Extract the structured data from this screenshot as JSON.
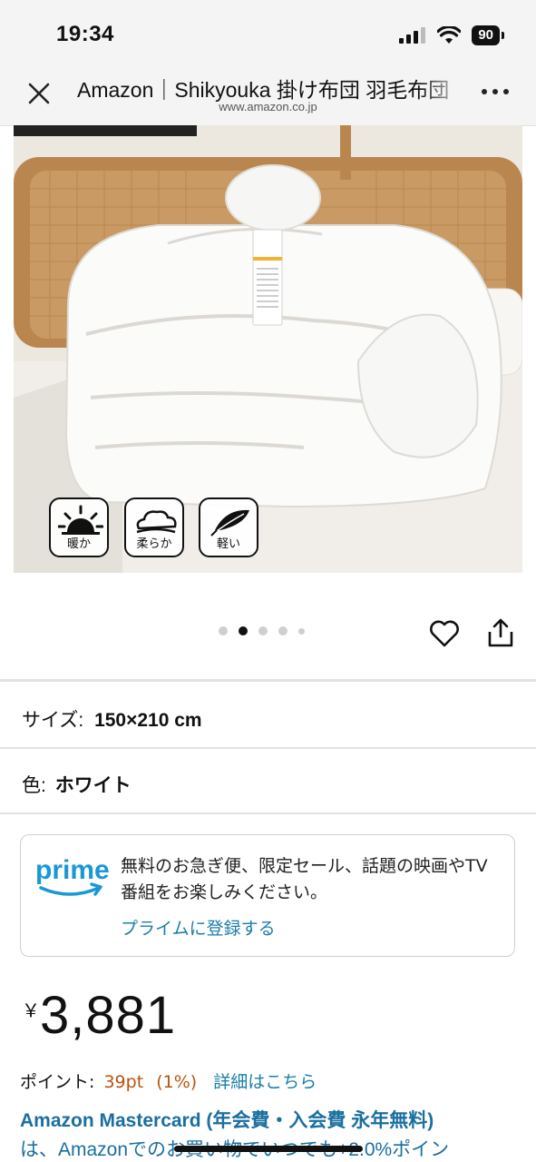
{
  "status_bar": {
    "time": "19:34",
    "battery": "90"
  },
  "nav": {
    "title": "Amazon｜Shikyouka 掛け布団 羽毛布団",
    "url": "www.amazon.co.jp"
  },
  "features": [
    {
      "icon": "sun-icon",
      "label": "暖か"
    },
    {
      "icon": "cloud-icon",
      "label": "柔らか"
    },
    {
      "icon": "feather-icon",
      "label": "軽い"
    }
  ],
  "carousel": {
    "total": 5,
    "active_index": 2
  },
  "size": {
    "label": "サイズ:",
    "value": "150×210 cm"
  },
  "color": {
    "label": "色:",
    "value": "ホワイト"
  },
  "prime": {
    "logo_text": "prime",
    "message": "無料のお急ぎ便、限定セール、話題の映画やTV番組をお楽しみください。",
    "link": "プライムに登録する"
  },
  "price": {
    "symbol": "￥",
    "value": "3,881"
  },
  "points": {
    "label": "ポイント:",
    "value": "39pt",
    "percent": "(1%)",
    "detail_link": "詳細はこちら"
  },
  "mastercard": {
    "line1": "Amazon Mastercard (年会費・入会費 永年無料)",
    "line2": "は、Amazonでのお買い物でいつでも+2.0%ポイン"
  },
  "colors": {
    "link": "#1a7ea8",
    "points": "#b9530e",
    "prime_blue": "#1a98d5"
  }
}
